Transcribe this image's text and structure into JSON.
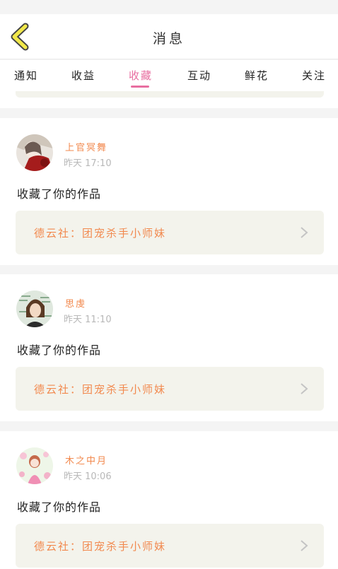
{
  "header": {
    "title": "消息",
    "back_icon": "chevron-left-icon",
    "accent": "#f1e84a"
  },
  "tabs": [
    {
      "label": "通知",
      "active": false
    },
    {
      "label": "收益",
      "active": false
    },
    {
      "label": "收藏",
      "active": true
    },
    {
      "label": "互动",
      "active": false
    },
    {
      "label": "鲜花",
      "active": false
    },
    {
      "label": "关注",
      "active": false
    }
  ],
  "colors": {
    "active_tab": "#e86ea0",
    "username": "#f2894e",
    "work_bg": "#f3f3ec"
  },
  "messages": [
    {
      "user": "上官冥舞",
      "time": "昨天 17:10",
      "action": "收藏了你的作品",
      "work": "德云社：团宠杀手小师妹"
    },
    {
      "user": "思虔",
      "time": "昨天 11:10",
      "action": "收藏了你的作品",
      "work": "德云社：团宠杀手小师妹"
    },
    {
      "user": "木之中月",
      "time": "昨天 10:06",
      "action": "收藏了你的作品",
      "work": "德云社：团宠杀手小师妹"
    }
  ]
}
